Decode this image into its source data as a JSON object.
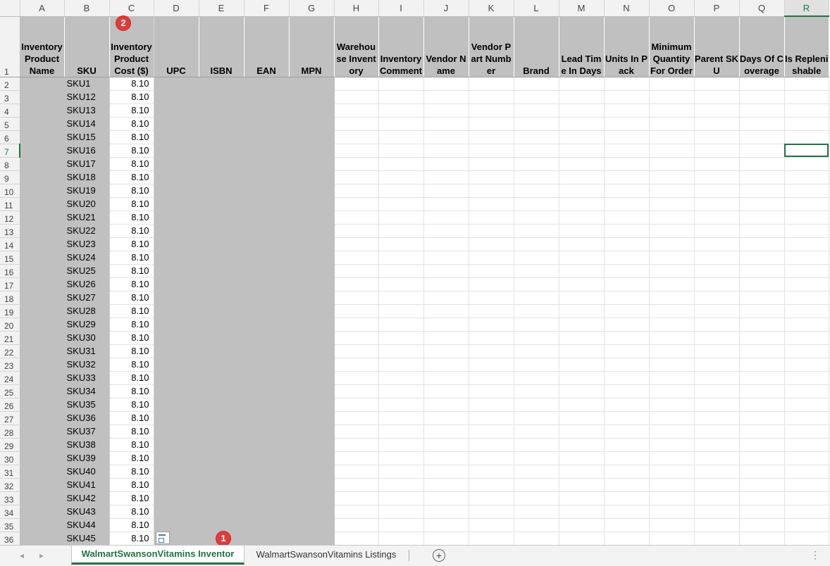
{
  "columns": [
    "A",
    "B",
    "C",
    "D",
    "E",
    "F",
    "G",
    "H",
    "I",
    "J",
    "K",
    "L",
    "M",
    "N",
    "O",
    "P",
    "Q",
    "R"
  ],
  "active_column": "R",
  "header_row_number": "1",
  "headers": [
    "Inventory Product Name",
    "SKU",
    "Inventory Product Cost ($)",
    "UPC",
    "ISBN",
    "EAN",
    "MPN",
    "Warehouse Inventory",
    "Inventory Comment",
    "Vendor Name",
    "Vendor Part Number",
    "Brand",
    "Lead Time In Days",
    "Units In Pack",
    "Minimum Quantity For Order",
    "Parent SKU",
    "Days Of Coverage",
    "Is Replenishable"
  ],
  "rows": [
    {
      "row": "2",
      "sku": "SKU1",
      "cost": "8.10"
    },
    {
      "row": "3",
      "sku": "SKU12",
      "cost": "8.10"
    },
    {
      "row": "4",
      "sku": "SKU13",
      "cost": "8.10"
    },
    {
      "row": "5",
      "sku": "SKU14",
      "cost": "8.10"
    },
    {
      "row": "6",
      "sku": "SKU15",
      "cost": "8.10"
    },
    {
      "row": "7",
      "sku": "SKU16",
      "cost": "8.10"
    },
    {
      "row": "8",
      "sku": "SKU17",
      "cost": "8.10"
    },
    {
      "row": "9",
      "sku": "SKU18",
      "cost": "8.10"
    },
    {
      "row": "10",
      "sku": "SKU19",
      "cost": "8.10"
    },
    {
      "row": "11",
      "sku": "SKU20",
      "cost": "8.10"
    },
    {
      "row": "12",
      "sku": "SKU21",
      "cost": "8.10"
    },
    {
      "row": "13",
      "sku": "SKU22",
      "cost": "8.10"
    },
    {
      "row": "14",
      "sku": "SKU23",
      "cost": "8.10"
    },
    {
      "row": "15",
      "sku": "SKU24",
      "cost": "8.10"
    },
    {
      "row": "16",
      "sku": "SKU25",
      "cost": "8.10"
    },
    {
      "row": "17",
      "sku": "SKU26",
      "cost": "8.10"
    },
    {
      "row": "18",
      "sku": "SKU27",
      "cost": "8.10"
    },
    {
      "row": "19",
      "sku": "SKU28",
      "cost": "8.10"
    },
    {
      "row": "20",
      "sku": "SKU29",
      "cost": "8.10"
    },
    {
      "row": "21",
      "sku": "SKU30",
      "cost": "8.10"
    },
    {
      "row": "22",
      "sku": "SKU31",
      "cost": "8.10"
    },
    {
      "row": "23",
      "sku": "SKU32",
      "cost": "8.10"
    },
    {
      "row": "24",
      "sku": "SKU33",
      "cost": "8.10"
    },
    {
      "row": "25",
      "sku": "SKU34",
      "cost": "8.10"
    },
    {
      "row": "26",
      "sku": "SKU35",
      "cost": "8.10"
    },
    {
      "row": "27",
      "sku": "SKU36",
      "cost": "8.10"
    },
    {
      "row": "28",
      "sku": "SKU37",
      "cost": "8.10"
    },
    {
      "row": "29",
      "sku": "SKU38",
      "cost": "8.10"
    },
    {
      "row": "30",
      "sku": "SKU39",
      "cost": "8.10"
    },
    {
      "row": "31",
      "sku": "SKU40",
      "cost": "8.10"
    },
    {
      "row": "32",
      "sku": "SKU41",
      "cost": "8.10"
    },
    {
      "row": "33",
      "sku": "SKU42",
      "cost": "8.10"
    },
    {
      "row": "34",
      "sku": "SKU43",
      "cost": "8.10"
    },
    {
      "row": "35",
      "sku": "SKU44",
      "cost": "8.10"
    },
    {
      "row": "36",
      "sku": "SKU45",
      "cost": "8.10"
    }
  ],
  "selected_cell": {
    "column": "R",
    "row": "7"
  },
  "markers": {
    "m1": "1",
    "m2": "2"
  },
  "tabs": {
    "active_sheet": "WalmartSwansonVitamins Inventor",
    "other_sheet": "WalmartSwansonVitamins Listings",
    "add_sheet": "+",
    "more_options": "⋮",
    "nav_prev": "◂",
    "nav_next": "▸"
  },
  "colors": {
    "accent": "#217346",
    "header_fill": "#c0c0c0",
    "marker": "#e03b3b"
  }
}
